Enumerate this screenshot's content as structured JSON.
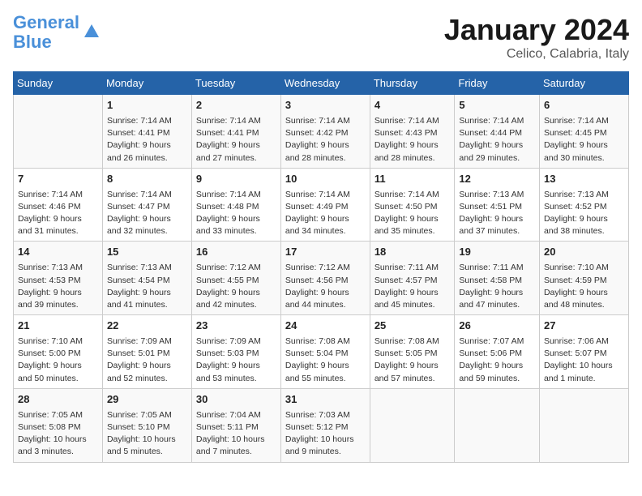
{
  "logo": {
    "line1": "General",
    "line2": "Blue"
  },
  "title": "January 2024",
  "subtitle": "Celico, Calabria, Italy",
  "headers": [
    "Sunday",
    "Monday",
    "Tuesday",
    "Wednesday",
    "Thursday",
    "Friday",
    "Saturday"
  ],
  "weeks": [
    [
      {
        "num": "",
        "info": ""
      },
      {
        "num": "1",
        "info": "Sunrise: 7:14 AM\nSunset: 4:41 PM\nDaylight: 9 hours\nand 26 minutes."
      },
      {
        "num": "2",
        "info": "Sunrise: 7:14 AM\nSunset: 4:41 PM\nDaylight: 9 hours\nand 27 minutes."
      },
      {
        "num": "3",
        "info": "Sunrise: 7:14 AM\nSunset: 4:42 PM\nDaylight: 9 hours\nand 28 minutes."
      },
      {
        "num": "4",
        "info": "Sunrise: 7:14 AM\nSunset: 4:43 PM\nDaylight: 9 hours\nand 28 minutes."
      },
      {
        "num": "5",
        "info": "Sunrise: 7:14 AM\nSunset: 4:44 PM\nDaylight: 9 hours\nand 29 minutes."
      },
      {
        "num": "6",
        "info": "Sunrise: 7:14 AM\nSunset: 4:45 PM\nDaylight: 9 hours\nand 30 minutes."
      }
    ],
    [
      {
        "num": "7",
        "info": "Sunrise: 7:14 AM\nSunset: 4:46 PM\nDaylight: 9 hours\nand 31 minutes."
      },
      {
        "num": "8",
        "info": "Sunrise: 7:14 AM\nSunset: 4:47 PM\nDaylight: 9 hours\nand 32 minutes."
      },
      {
        "num": "9",
        "info": "Sunrise: 7:14 AM\nSunset: 4:48 PM\nDaylight: 9 hours\nand 33 minutes."
      },
      {
        "num": "10",
        "info": "Sunrise: 7:14 AM\nSunset: 4:49 PM\nDaylight: 9 hours\nand 34 minutes."
      },
      {
        "num": "11",
        "info": "Sunrise: 7:14 AM\nSunset: 4:50 PM\nDaylight: 9 hours\nand 35 minutes."
      },
      {
        "num": "12",
        "info": "Sunrise: 7:13 AM\nSunset: 4:51 PM\nDaylight: 9 hours\nand 37 minutes."
      },
      {
        "num": "13",
        "info": "Sunrise: 7:13 AM\nSunset: 4:52 PM\nDaylight: 9 hours\nand 38 minutes."
      }
    ],
    [
      {
        "num": "14",
        "info": "Sunrise: 7:13 AM\nSunset: 4:53 PM\nDaylight: 9 hours\nand 39 minutes."
      },
      {
        "num": "15",
        "info": "Sunrise: 7:13 AM\nSunset: 4:54 PM\nDaylight: 9 hours\nand 41 minutes."
      },
      {
        "num": "16",
        "info": "Sunrise: 7:12 AM\nSunset: 4:55 PM\nDaylight: 9 hours\nand 42 minutes."
      },
      {
        "num": "17",
        "info": "Sunrise: 7:12 AM\nSunset: 4:56 PM\nDaylight: 9 hours\nand 44 minutes."
      },
      {
        "num": "18",
        "info": "Sunrise: 7:11 AM\nSunset: 4:57 PM\nDaylight: 9 hours\nand 45 minutes."
      },
      {
        "num": "19",
        "info": "Sunrise: 7:11 AM\nSunset: 4:58 PM\nDaylight: 9 hours\nand 47 minutes."
      },
      {
        "num": "20",
        "info": "Sunrise: 7:10 AM\nSunset: 4:59 PM\nDaylight: 9 hours\nand 48 minutes."
      }
    ],
    [
      {
        "num": "21",
        "info": "Sunrise: 7:10 AM\nSunset: 5:00 PM\nDaylight: 9 hours\nand 50 minutes."
      },
      {
        "num": "22",
        "info": "Sunrise: 7:09 AM\nSunset: 5:01 PM\nDaylight: 9 hours\nand 52 minutes."
      },
      {
        "num": "23",
        "info": "Sunrise: 7:09 AM\nSunset: 5:03 PM\nDaylight: 9 hours\nand 53 minutes."
      },
      {
        "num": "24",
        "info": "Sunrise: 7:08 AM\nSunset: 5:04 PM\nDaylight: 9 hours\nand 55 minutes."
      },
      {
        "num": "25",
        "info": "Sunrise: 7:08 AM\nSunset: 5:05 PM\nDaylight: 9 hours\nand 57 minutes."
      },
      {
        "num": "26",
        "info": "Sunrise: 7:07 AM\nSunset: 5:06 PM\nDaylight: 9 hours\nand 59 minutes."
      },
      {
        "num": "27",
        "info": "Sunrise: 7:06 AM\nSunset: 5:07 PM\nDaylight: 10 hours\nand 1 minute."
      }
    ],
    [
      {
        "num": "28",
        "info": "Sunrise: 7:05 AM\nSunset: 5:08 PM\nDaylight: 10 hours\nand 3 minutes."
      },
      {
        "num": "29",
        "info": "Sunrise: 7:05 AM\nSunset: 5:10 PM\nDaylight: 10 hours\nand 5 minutes."
      },
      {
        "num": "30",
        "info": "Sunrise: 7:04 AM\nSunset: 5:11 PM\nDaylight: 10 hours\nand 7 minutes."
      },
      {
        "num": "31",
        "info": "Sunrise: 7:03 AM\nSunset: 5:12 PM\nDaylight: 10 hours\nand 9 minutes."
      },
      {
        "num": "",
        "info": ""
      },
      {
        "num": "",
        "info": ""
      },
      {
        "num": "",
        "info": ""
      }
    ]
  ]
}
